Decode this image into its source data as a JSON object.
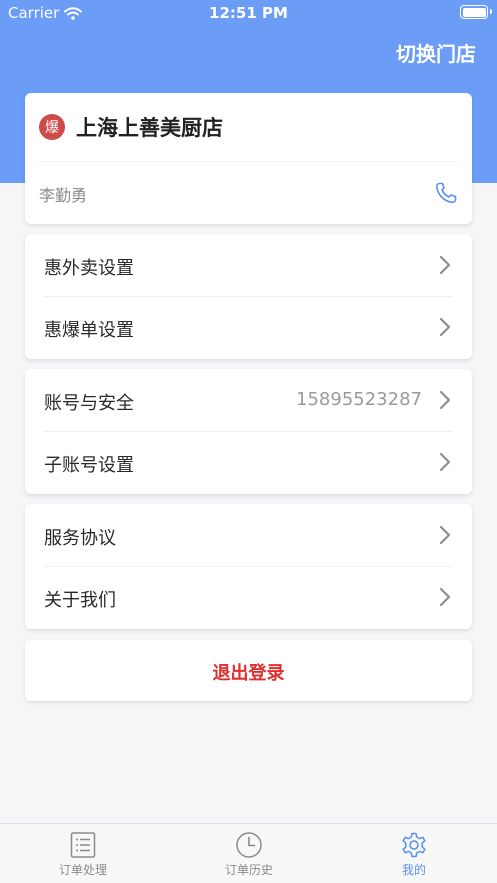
{
  "status_bar": {
    "carrier": "Carrier",
    "time": "12:51 PM"
  },
  "header": {
    "switch_store_label": "切换门店"
  },
  "store": {
    "badge": "爆",
    "name": "上海上善美厨店",
    "owner": "李勤勇"
  },
  "menu_groups": [
    {
      "items": [
        {
          "label": "惠外卖设置"
        },
        {
          "label": "惠爆单设置"
        }
      ]
    },
    {
      "items": [
        {
          "label": "账号与安全",
          "value": "15895523287"
        },
        {
          "label": "子账号设置"
        }
      ]
    },
    {
      "items": [
        {
          "label": "服务协议"
        },
        {
          "label": "关于我们"
        }
      ]
    }
  ],
  "logout_label": "退出登录",
  "tabbar": {
    "tabs": [
      {
        "label": "订单处理",
        "icon": "list-icon"
      },
      {
        "label": "订单历史",
        "icon": "clock-icon"
      },
      {
        "label": "我的",
        "icon": "gear-icon",
        "active": true
      }
    ]
  },
  "colors": {
    "header": "#6b9cf6",
    "accent": "#5a8ef2",
    "logout": "#e02f2f",
    "badge": "#cf4b4b"
  }
}
